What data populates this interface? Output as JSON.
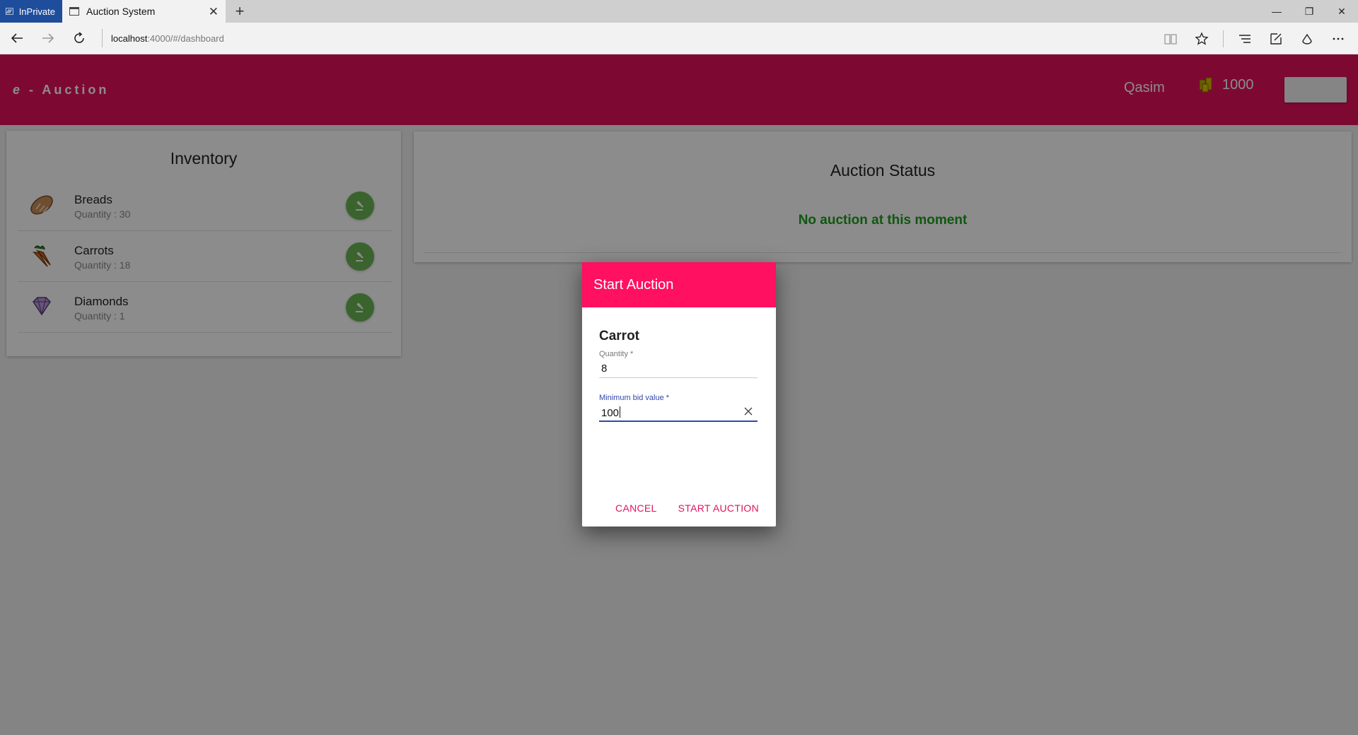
{
  "browser": {
    "inprivate_label": "InPrivate",
    "tab_title": "Auction System",
    "url_host": "localhost",
    "url_rest": ":4000/#/dashboard"
  },
  "appbar": {
    "brand_e": "e",
    "brand_rest": " - Auction",
    "username": "Qasim",
    "coins": "1000"
  },
  "inventory": {
    "title": "Inventory",
    "items": [
      {
        "name": "Breads",
        "quantity": "Quantity : 30"
      },
      {
        "name": "Carrots",
        "quantity": "Quantity : 18"
      },
      {
        "name": "Diamonds",
        "quantity": "Quantity : 1"
      }
    ]
  },
  "auction_status": {
    "title": "Auction Status",
    "message": "No auction at this moment"
  },
  "dialog": {
    "title": "Start Auction",
    "item": "Carrot",
    "quantity_label": "Quantity *",
    "quantity_value": "8",
    "min_bid_label": "Minimum bid value *",
    "min_bid_value": "100",
    "cancel_label": "CANCEL",
    "start_label": "START AUCTION"
  },
  "colors": {
    "appbar": "#e4125e",
    "dialog_header": "#ff1060",
    "gavel_button": "#6ab553",
    "status_message": "#1e9e1e",
    "focus": "#3346a9"
  }
}
